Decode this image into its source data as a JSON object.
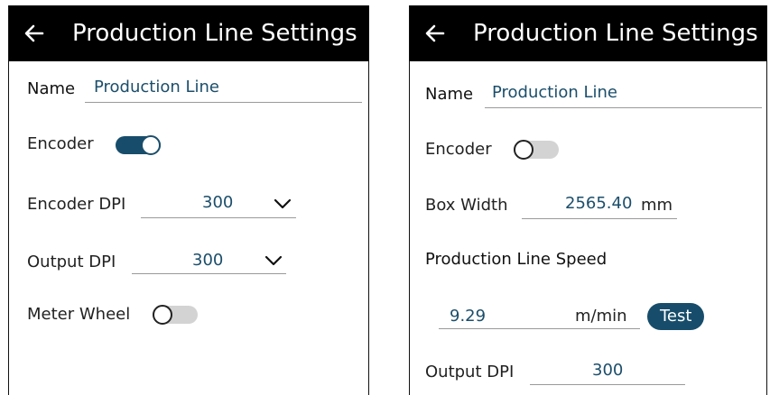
{
  "left_panel": {
    "title": "Production Line Settings",
    "name_label": "Name",
    "name_value": "Production Line",
    "encoder_label": "Encoder",
    "encoder_on": true,
    "encoder_dpi_label": "Encoder DPI",
    "encoder_dpi_value": "300",
    "output_dpi_label": "Output DPI",
    "output_dpi_value": "300",
    "meter_wheel_label": "Meter Wheel",
    "meter_wheel_on": false
  },
  "right_panel": {
    "title": "Production Line Settings",
    "name_label": "Name",
    "name_value": "Production Line",
    "encoder_label": "Encoder",
    "encoder_on": false,
    "box_width_label": "Box Width",
    "box_width_value": "2565.40",
    "box_width_unit": "mm",
    "line_speed_heading": "Production Line Speed",
    "line_speed_value": "9.29",
    "line_speed_unit": "m/min",
    "test_button_label": "Test",
    "output_dpi_label": "Output DPI",
    "output_dpi_value": "300"
  },
  "colors": {
    "accent": "#174d6b",
    "header_bg": "#000000",
    "value_text": "#1b4e6b",
    "toggle_off_track": "#d3d3d3"
  },
  "icons": {
    "back": "arrow-left-icon",
    "dropdown": "chevron-down-icon"
  }
}
